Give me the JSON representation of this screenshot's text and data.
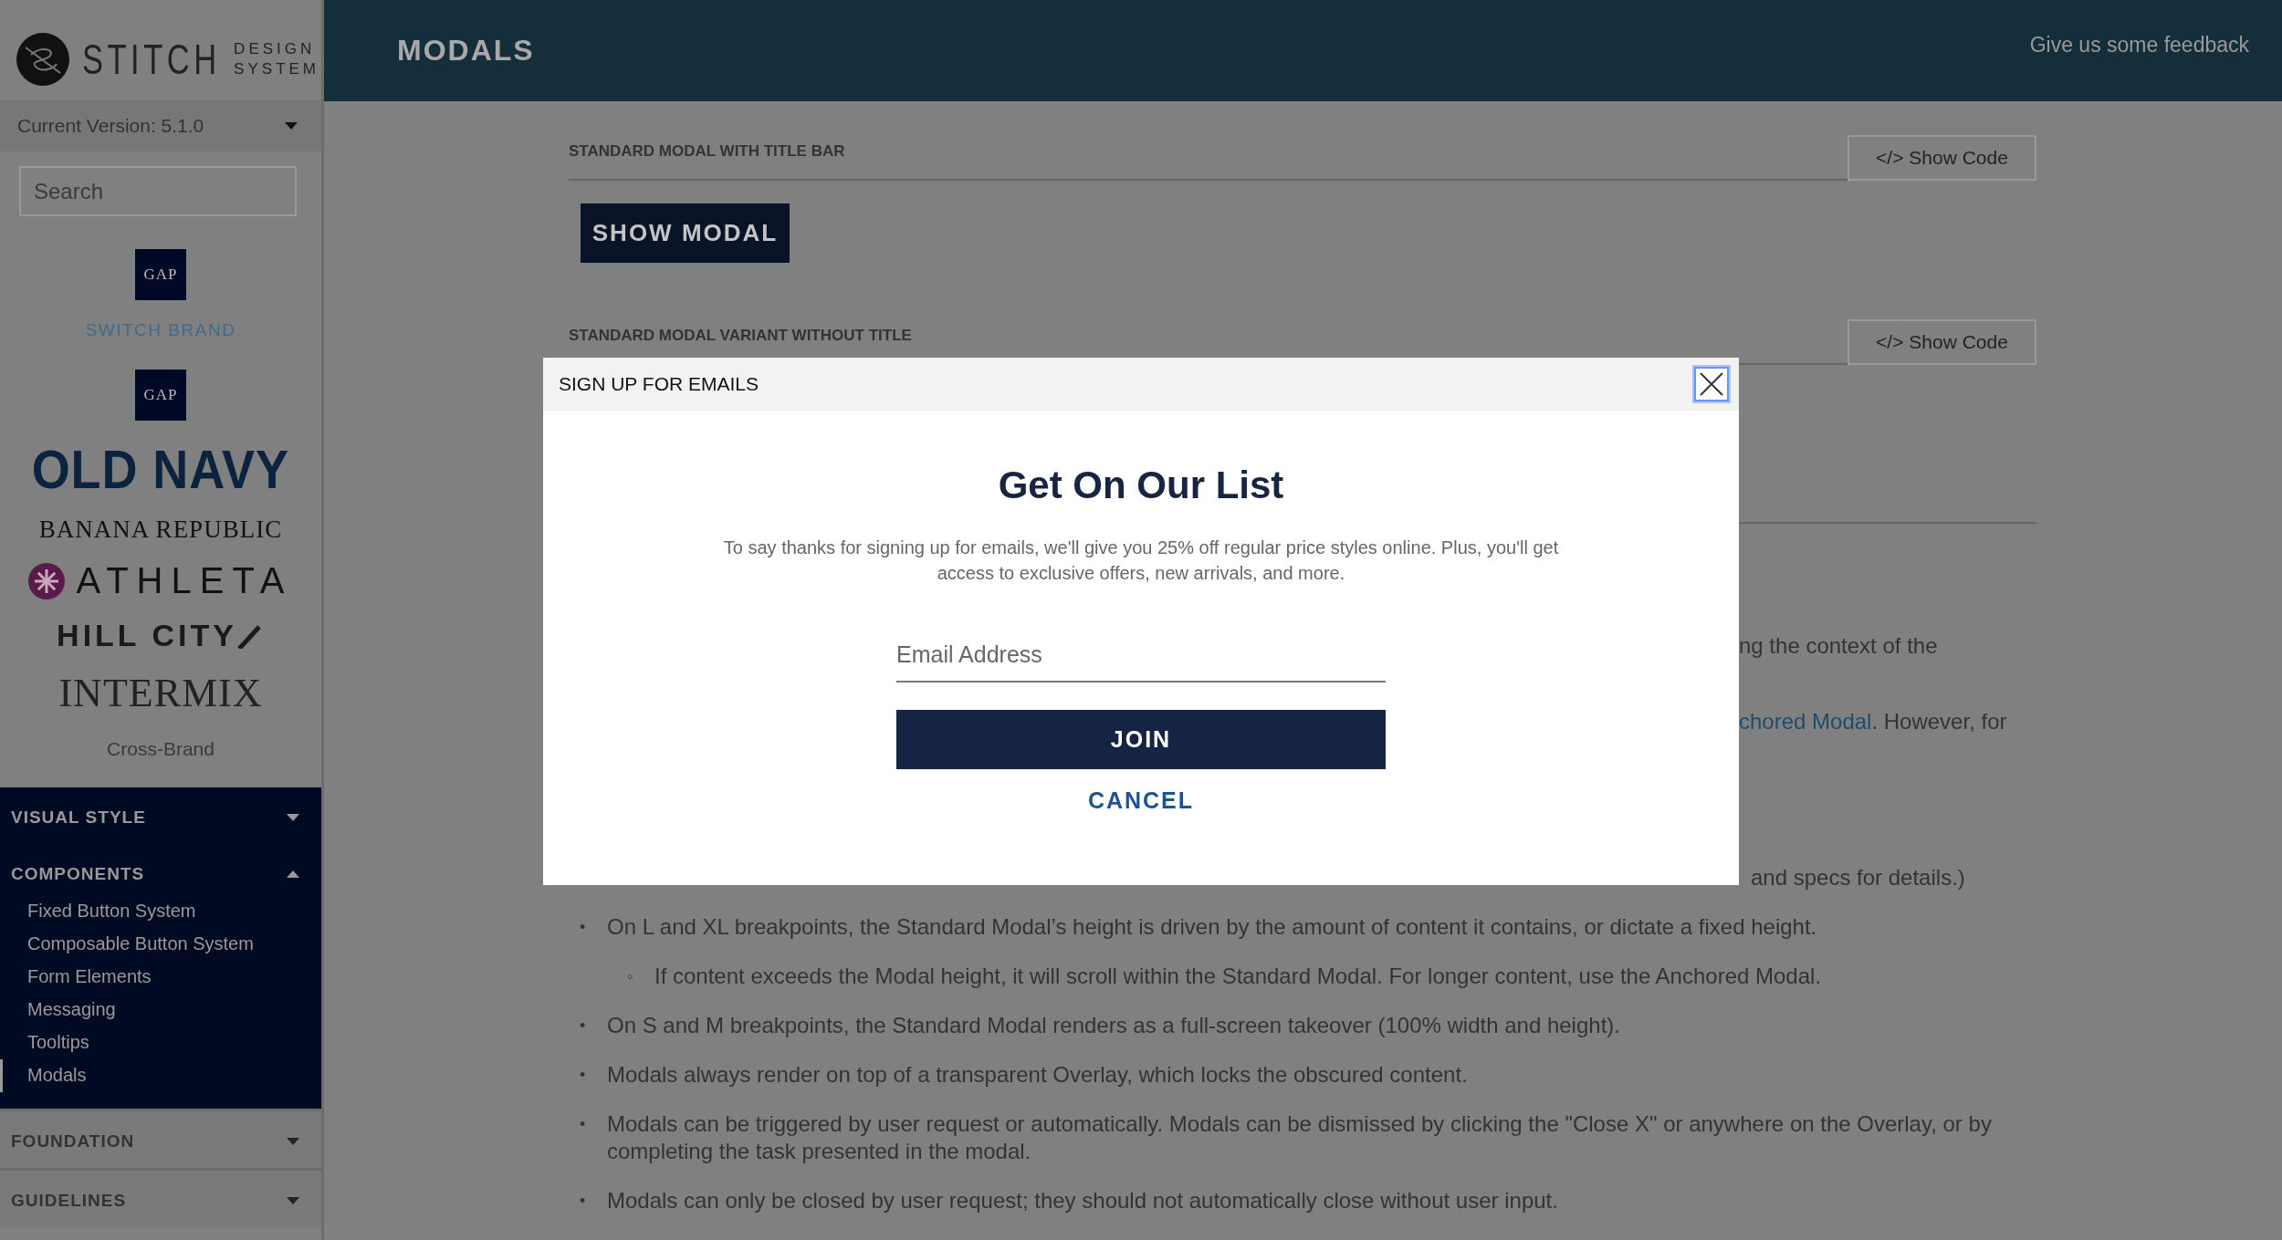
{
  "sidebar": {
    "logo": {
      "name": "STITCH",
      "subtitle": [
        "DESIGN",
        "SYSTEM"
      ]
    },
    "version": "Current Version: 5.1.0",
    "search": {
      "placeholder": "Search"
    },
    "current_brand": {
      "label": "GAP"
    },
    "switch_brand": "SWITCH BRAND",
    "brands": [
      {
        "kind": "box",
        "label": "GAP"
      },
      {
        "kind": "heavy",
        "label": "OLD NAVY"
      },
      {
        "kind": "serif",
        "label": "BANANA REPUBLIC"
      },
      {
        "kind": "flower",
        "label": "ATHLETA"
      },
      {
        "kind": "slash",
        "label": "HILL CITY"
      },
      {
        "kind": "thin",
        "label": "INTERMIX"
      },
      {
        "kind": "plain",
        "label": "Cross-Brand"
      }
    ],
    "sections": [
      {
        "title": "VISUAL STYLE",
        "expanded": false,
        "dark": true
      },
      {
        "title": "COMPONENTS",
        "expanded": true,
        "dark": true,
        "items": [
          {
            "label": "Fixed Button System",
            "selected": false
          },
          {
            "label": "Composable Button System",
            "selected": false
          },
          {
            "label": "Form Elements",
            "selected": false
          },
          {
            "label": "Messaging",
            "selected": false
          },
          {
            "label": "Tooltips",
            "selected": false
          },
          {
            "label": "Modals",
            "selected": true
          }
        ]
      },
      {
        "title": "FOUNDATION",
        "expanded": false,
        "dark": false
      },
      {
        "title": "GUIDELINES",
        "expanded": false,
        "dark": false
      }
    ]
  },
  "header": {
    "title": "MODALS",
    "feedback_link": "Give us some feedback"
  },
  "examples": [
    {
      "title": "STANDARD MODAL WITH TITLE BAR",
      "code_button": "</> Show Code",
      "demo_button": "SHOW MODAL"
    },
    {
      "title": "STANDARD MODAL VARIANT WITHOUT TITLE",
      "code_button": "</> Show Code"
    }
  ],
  "fragments": [
    {
      "text": "ng the context of the"
    },
    {
      "link": "chored Modal",
      "text": ". However, for"
    }
  ],
  "bullet_tail": {
    "text": "and specs for details.)"
  },
  "bullets": [
    {
      "marker": "•",
      "text": "On L and XL breakpoints, the Standard Modal’s height is driven by the amount of content it contains, or dictate a fixed height.",
      "children": [
        {
          "marker": "◦",
          "text": "If content exceeds the Modal height, it will scroll within the Standard Modal. For longer content, use the Anchored Modal."
        }
      ]
    },
    {
      "marker": "•",
      "text": "On S and M breakpoints, the Standard Modal renders as a full-screen takeover (100% width and height)."
    },
    {
      "marker": "•",
      "text": "Modals always render on top of a transparent Overlay, which locks the obscured content."
    },
    {
      "marker": "•",
      "text": "Modals can be triggered by user request or automatically. Modals can be dismissed by clicking the \"Close X\" or anywhere on the Overlay, or by completing the task presented in the modal."
    },
    {
      "marker": "•",
      "text": "Modals can only be closed by user request; they should not automatically close without user input."
    }
  ],
  "modal": {
    "title": "SIGN UP FOR EMAILS",
    "heading": "Get On Our List",
    "message": "To say thanks for signing up for emails, we'll give you 25% off regular price styles online. Plus, you'll get access to exclusive offers, new arrivals, and more.",
    "email": {
      "placeholder": "Email Address"
    },
    "join": "JOIN",
    "cancel": "CANCEL"
  }
}
